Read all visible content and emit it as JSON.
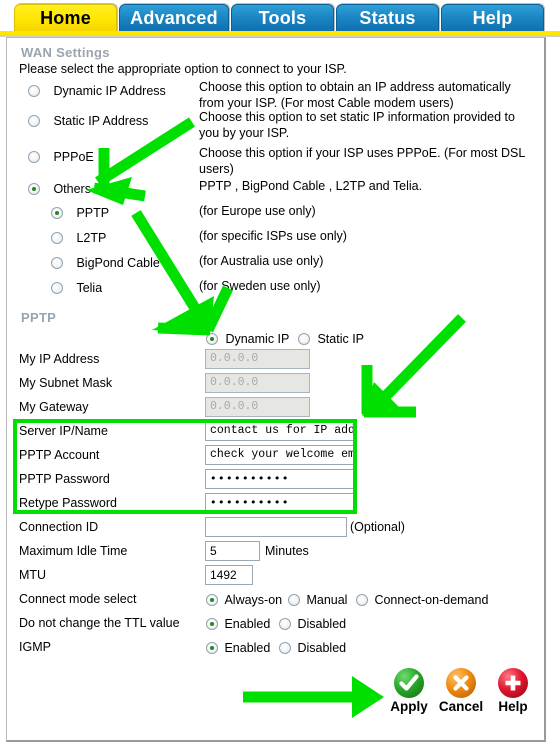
{
  "nav": {
    "tabs": [
      {
        "label": "Home",
        "active": true
      },
      {
        "label": "Advanced",
        "active": false
      },
      {
        "label": "Tools",
        "active": false
      },
      {
        "label": "Status",
        "active": false
      },
      {
        "label": "Help",
        "active": false
      }
    ]
  },
  "wan": {
    "section_title": "WAN Settings",
    "instruction": "Please select the appropriate option to connect to your ISP.",
    "options": [
      {
        "label": "Dynamic IP Address",
        "selected": false,
        "description": "Choose this option to obtain an IP address automatically from your ISP. (For most Cable modem users)"
      },
      {
        "label": "Static IP Address",
        "selected": false,
        "description": "Choose this option to set static IP information provided to you by your ISP."
      },
      {
        "label": "PPPoE",
        "selected": false,
        "description": "Choose this option if your ISP uses PPPoE. (For most DSL users)"
      },
      {
        "label": "Others",
        "selected": true,
        "description": "PPTP , BigPond Cable , L2TP and Telia."
      }
    ],
    "sub_options": [
      {
        "label": "PPTP",
        "selected": true,
        "description": "(for Europe use only)"
      },
      {
        "label": "L2TP",
        "selected": false,
        "description": "(for specific ISPs use only)"
      },
      {
        "label": "BigPond Cable",
        "selected": false,
        "description": "(for Australia use only)"
      },
      {
        "label": "Telia",
        "selected": false,
        "description": "(for Sweden use only)"
      }
    ]
  },
  "pptp": {
    "section_title": "PPTP",
    "addr_mode": {
      "dynamic_label": "Dynamic IP",
      "static_label": "Static IP",
      "selected": "Dynamic IP"
    },
    "fields": {
      "my_ip_address": {
        "label": "My IP Address",
        "value": "0.0.0.0",
        "disabled": true
      },
      "my_subnet_mask": {
        "label": "My Subnet Mask",
        "value": "0.0.0.0",
        "disabled": true
      },
      "my_gateway": {
        "label": "My Gateway",
        "value": "0.0.0.0",
        "disabled": true
      },
      "server_ip_name": {
        "label": "Server IP/Name",
        "value": "contact us for IP address",
        "disabled": false
      },
      "pptp_account": {
        "label": "PPTP Account",
        "value": "check your welcome email",
        "disabled": false
      },
      "pptp_password": {
        "label": "PPTP Password",
        "value": "••••••••••",
        "disabled": false
      },
      "retype_password": {
        "label": "Retype Password",
        "value": "••••••••••",
        "disabled": false
      },
      "connection_id": {
        "label": "Connection ID",
        "value": "",
        "suffix": "(Optional)",
        "disabled": false
      },
      "max_idle_time": {
        "label": "Maximum Idle Time",
        "value": "5",
        "suffix": "Minutes",
        "disabled": false
      },
      "mtu": {
        "label": "MTU",
        "value": "1492",
        "disabled": false
      }
    },
    "connect_mode": {
      "label": "Connect mode select",
      "options": [
        "Always-on",
        "Manual",
        "Connect-on-demand"
      ],
      "selected": "Always-on"
    },
    "ttl": {
      "label": "Do not change the TTL value",
      "options": [
        "Enabled",
        "Disabled"
      ],
      "selected": "Enabled"
    },
    "igmp": {
      "label": "IGMP",
      "options": [
        "Enabled",
        "Disabled"
      ],
      "selected": "Enabled"
    }
  },
  "actions": [
    {
      "label": "Apply",
      "icon": "green-check-icon"
    },
    {
      "label": "Cancel",
      "icon": "orange-x-icon"
    },
    {
      "label": "Help",
      "icon": "red-plus-icon"
    }
  ],
  "annotations": {
    "highlight_color": "#00e000",
    "arrow_count": 4,
    "highlight_box_target": "credentials-fields"
  },
  "colors": {
    "active_tab": "#ffe500",
    "inactive_tab": "#1b86c4",
    "section_title": "#9aa4ae",
    "annotation_green": "#00e000"
  }
}
